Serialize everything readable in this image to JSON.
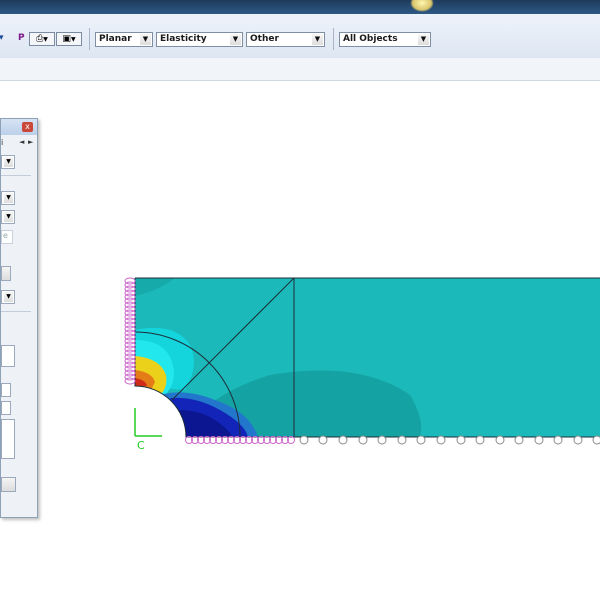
{
  "toolbar": {
    "mode_label": "P",
    "analysis_type": "Planar",
    "material_model": "Elasticity",
    "other_select": "Other",
    "object_filter": "All Objects",
    "icons": [
      "toolbar-arrow-icon",
      "print-icon",
      "model-tree-icon"
    ]
  },
  "side_panel": {
    "close_glyph": "x",
    "tab_partial": "i",
    "nav_prev": "◄",
    "nav_next": "►",
    "faded_button": "e"
  },
  "viewport": {
    "axis_label": "C",
    "contour_colors": {
      "background_teal": "#1bb9b9",
      "dark_teal": "#15a2a2",
      "mid_blue": "#2277cc",
      "deep_blue": "#1225b8",
      "navy": "#0b1690",
      "cyan": "#14e0e8",
      "yellow": "#ecd11b",
      "orange": "#e37b17",
      "red": "#cf2b18"
    },
    "boundary_marker_color": "#cc66cc",
    "axis_color": "#22cc22"
  }
}
